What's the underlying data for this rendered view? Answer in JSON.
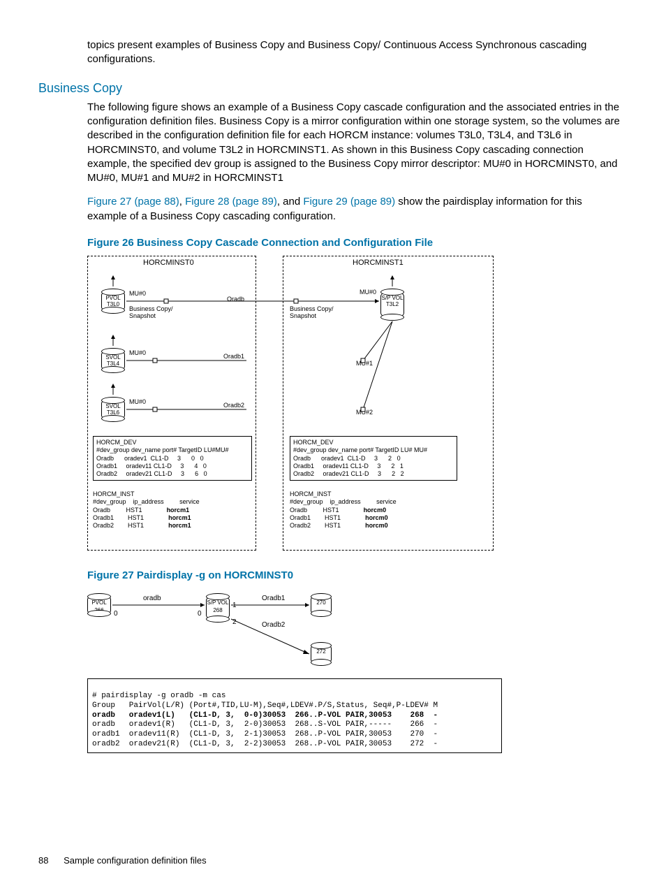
{
  "intro": "topics present examples of Business Copy and Business Copy/ Continuous Access Synchronous cascading configurations.",
  "section_heading": "Business Copy",
  "paragraph1": "The following figure shows an example of a Business Copy cascade configuration and the associated entries in the configuration definition files. Business Copy is a mirror configuration within one storage system, so the volumes are described in the configuration definition file for each HORCM instance: volumes T3L0, T3L4, and T3L6 in HORCMINST0, and volume T3L2 in HORCMINST1. As shown in this Business Copy cascading connection example, the specified dev group is assigned to the Business Copy mirror descriptor: MU#0 in HORCMINST0, and MU#0, MU#1 and MU#2 in HORCMINST1",
  "link1": "Figure 27 (page 88)",
  "link_sep1": ", ",
  "link2": "Figure 28 (page 89)",
  "link_sep2": ", and ",
  "link3": "Figure 29 (page 89)",
  "links_tail": " show the pairdisplay information for this example of a Business Copy cascading configuration.",
  "figure26_caption": "Figure 26 Business Copy Cascade Connection and Configuration File",
  "figure27_caption": "Figure 27 Pairdisplay -g on HORCMINST0",
  "fig26": {
    "left_title": "HORCMINST0",
    "right_title": "HORCMINST1",
    "pvol": "PVOL\nT3L0",
    "svol1": "SVOL\nT3L4",
    "svol2": "SVOL\nT3L6",
    "spvol": "S/P\nVOL\nT3L2",
    "mu0": "MU#0",
    "mu1": "MU#1",
    "mu2": "MU#2",
    "bc": "Business Copy/\nSnapshot",
    "oradb": "Oradb",
    "oradb1": "Oradb1",
    "oradb2": "Oradb2",
    "horcm_dev": "HORCM_DEV",
    "dev_header": "#dev_group dev_name port# TargetID LU#MU#",
    "left_dev_rows": [
      "Oradb      oradev1  CL1-D     3      0   0",
      "Oradb1     oradev11 CL1-D     3      4   0",
      "Oradb2     oradev21 CL1-D     3      6   0"
    ],
    "right_dev_header": "#dev_group dev_name port# TargetID LU# MU#",
    "right_dev_rows": [
      "Oradb      oradev1  CL1-D     3      2   0",
      "Oradb1     oradev11 CL1-D     3      2   1",
      "Oradb2     oradev21 CL1-D     3      2   2"
    ],
    "horcm_inst": "HORCM_INST",
    "inst_header": "#dev_group    ip_address         service",
    "left_inst_rows": [
      {
        "g": "Oradb",
        "ip": "HST1",
        "svc": "horcm1"
      },
      {
        "g": "Oradb1",
        "ip": "HST1",
        "svc": "horcm1"
      },
      {
        "g": "Oradb2",
        "ip": "HST1",
        "svc": "horcm1"
      }
    ],
    "right_inst_rows": [
      {
        "g": "Oradb",
        "ip": "HST1",
        "svc": "horcm0"
      },
      {
        "g": "Oradb1",
        "ip": "HST1",
        "svc": "horcm0"
      },
      {
        "g": "Oradb2",
        "ip": "HST1",
        "svc": "horcm0"
      }
    ]
  },
  "fig27": {
    "pvol": "PVOL\n266",
    "spvol": "S/P\nVOL\n268",
    "v270": "270",
    "v272": "272",
    "oradb": "oradb",
    "oradb1": "Oradb1",
    "oradb2": "Oradb2",
    "n0a": "0",
    "n0b": "0",
    "n1": "1",
    "n2": "2"
  },
  "codebox": {
    "cmd": "# pairdisplay -g oradb -m cas",
    "header": "Group   PairVol(L/R) (Port#,TID,LU-M),Seq#,LDEV#.P/S,Status, Seq#,P-LDEV# M",
    "rows": [
      {
        "bold": true,
        "text": "oradb   oradev1(L)   (CL1-D, 3,  0-0)30053  266..P-VOL PAIR,30053    268  -"
      },
      {
        "bold": false,
        "text": "oradb   oradev1(R)   (CL1-D, 3,  2-0)30053  268..S-VOL PAIR,-----    266  -"
      },
      {
        "bold": false,
        "text": "oradb1  oradev11(R)  (CL1-D, 3,  2-1)30053  268..P-VOL PAIR,30053    270  -"
      },
      {
        "bold": false,
        "text": "oradb2  oradev21(R)  (CL1-D, 3,  2-2)30053  268..P-VOL PAIR,30053    272  -"
      }
    ]
  },
  "page_number": "88",
  "footer_text": "Sample configuration definition files"
}
